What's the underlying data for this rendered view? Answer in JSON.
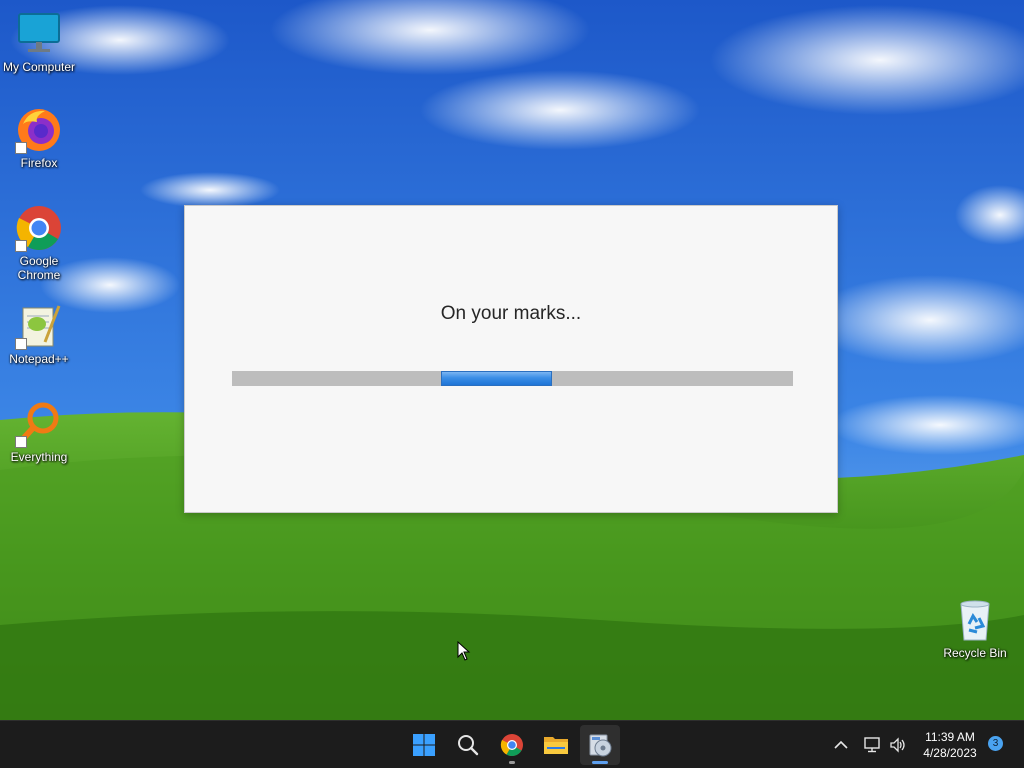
{
  "desktop": {
    "icons": [
      {
        "label": "My Computer",
        "icon": "monitor-icon"
      },
      {
        "label": "Firefox",
        "icon": "firefox-icon"
      },
      {
        "label": "Google Chrome",
        "icon": "chrome-icon"
      },
      {
        "label": "Notepad++",
        "icon": "notepadpp-icon"
      },
      {
        "label": "Everything",
        "icon": "everything-search-icon"
      },
      {
        "label": "Recycle Bin",
        "icon": "recycle-bin-icon"
      }
    ]
  },
  "dialog": {
    "message": "On your marks...",
    "progress": {
      "start_fraction": 0.372,
      "end_fraction": 0.57,
      "indeterminate": true
    }
  },
  "taskbar": {
    "apps": [
      {
        "name": "Start",
        "icon": "windows-start-icon"
      },
      {
        "name": "Search",
        "icon": "search-icon"
      },
      {
        "name": "Google Chrome",
        "icon": "chrome-icon",
        "running": true
      },
      {
        "name": "File Explorer",
        "icon": "folder-icon"
      },
      {
        "name": "Installer",
        "icon": "installer-icon",
        "running": true,
        "active": true
      }
    ],
    "tray": {
      "time": "11:39 AM",
      "date": "4/28/2023",
      "notification_count": "3",
      "icons": [
        "chevron-up-icon",
        "network-icon",
        "volume-icon"
      ]
    }
  },
  "colors": {
    "sky": "#2d6ed6",
    "grass": "#4a9a1e",
    "taskbar": "#1c1c1c",
    "progress": "#3a8ee6",
    "dialog": "#f7f7f7"
  }
}
